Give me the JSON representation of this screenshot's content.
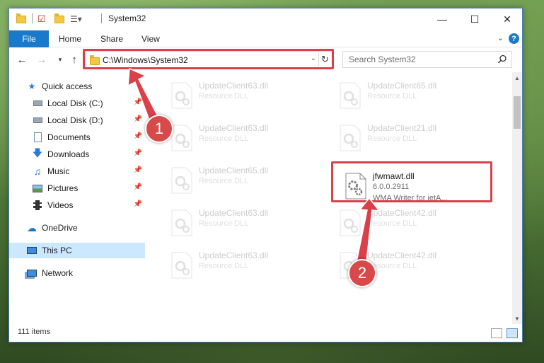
{
  "window": {
    "title": "System32",
    "minimize": "—",
    "maximize": "☐",
    "close": "✕"
  },
  "ribbon": {
    "tabs": [
      "File",
      "Home",
      "Share",
      "View"
    ],
    "help": "?"
  },
  "address": {
    "path": "C:\\Windows\\System32"
  },
  "search": {
    "placeholder": "Search System32"
  },
  "nav": {
    "items": [
      {
        "label": "Quick access",
        "icon": "star-icon"
      },
      {
        "label": "Local Disk (C:)",
        "icon": "drive-icon",
        "pinned": true
      },
      {
        "label": "Local Disk (D:)",
        "icon": "drive-icon",
        "pinned": true
      },
      {
        "label": "Documents",
        "icon": "documents-icon",
        "pinned": true
      },
      {
        "label": "Downloads",
        "icon": "download-icon",
        "pinned": true
      },
      {
        "label": "Music",
        "icon": "music-icon",
        "pinned": true
      },
      {
        "label": "Pictures",
        "icon": "pictures-icon",
        "pinned": true
      },
      {
        "label": "Videos",
        "icon": "videos-icon",
        "pinned": true
      },
      {
        "label": "OneDrive",
        "icon": "cloud-icon"
      },
      {
        "label": "This PC",
        "icon": "computer-icon",
        "selected": true
      },
      {
        "label": "Network",
        "icon": "network-icon"
      }
    ]
  },
  "files": [
    {
      "name": "UpdateClient63.dll",
      "desc": "Resource DLL"
    },
    {
      "name": "UpdateClient65.dll",
      "desc": "Resource DLL"
    },
    {
      "name": "UpdateClient63.dll",
      "desc": "Resource DLL"
    },
    {
      "name": "UpdateClient21.dll",
      "desc": "Resource DLL"
    },
    {
      "name": "UpdateClient65.dll",
      "desc": "Resource DLL"
    },
    {
      "name": "jfwmawt.dll",
      "desc": "6.0.0.2911",
      "desc2": "WMA Writer for jetA..."
    },
    {
      "name": "UpdateClient63.dll",
      "desc": "Resource DLL"
    },
    {
      "name": "UpdateClient42.dll",
      "desc": "Resource DLL"
    },
    {
      "name": "UpdateClient63.dll",
      "desc": "Resource DLL"
    },
    {
      "name": "UpdateClient42.dll",
      "desc": "Resource DLL"
    }
  ],
  "status": {
    "items_count": "111 items"
  },
  "annotations": {
    "step1": "1",
    "step2": "2",
    "color": "#d9404a"
  }
}
